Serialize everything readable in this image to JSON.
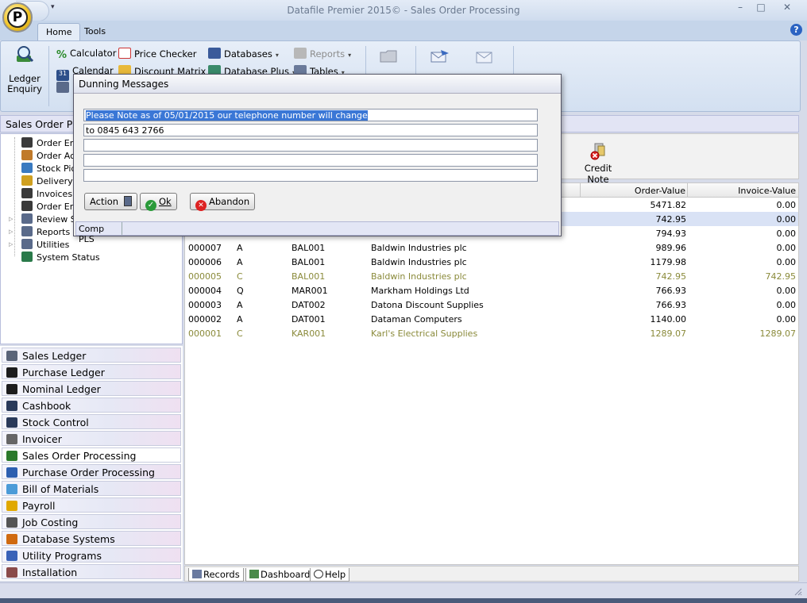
{
  "window": {
    "title": "Datafile  Premier 2015© - Sales Order Processing",
    "logo_letter": "P",
    "qat_arrow": "▾",
    "minimize": "–",
    "maximize": "□",
    "close": "✕"
  },
  "ribbon": {
    "tabs": [
      "Home",
      "Tools"
    ],
    "help": "?",
    "ledger_enquiry": [
      "Ledger",
      "Enquiry"
    ],
    "calculator": "Calculator",
    "calendar": "Calendar",
    "price_checker": "Price Checker",
    "discount_matrix": "Discount Matrix",
    "databases": "Databases",
    "database_plus": "Database Plus",
    "reports": "Reports",
    "tables": "Tables",
    "dropdown_arrow": "▾"
  },
  "left_panel": {
    "header": "Sales Order Processing",
    "tree": [
      {
        "label": "Order Entry",
        "icon": "person-icon"
      },
      {
        "label": "Order Acknowledgement",
        "icon": "briefcase-icon"
      },
      {
        "label": "Stock Picking",
        "icon": "box-icon"
      },
      {
        "label": "Delivery Notes",
        "icon": "document-icon"
      },
      {
        "label": "Invoices",
        "icon": "person-icon"
      },
      {
        "label": "Order Enquiry",
        "icon": "person-icon"
      },
      {
        "label": "Review Sales",
        "icon": "list-icon"
      },
      {
        "label": "Reports",
        "icon": "list-icon"
      },
      {
        "label": "Utilities",
        "icon": "list-icon"
      },
      {
        "label": "System Status",
        "icon": "book-icon"
      }
    ],
    "expander": "▷",
    "modules": [
      {
        "label": "Sales Ledger",
        "color": "#5a6478"
      },
      {
        "label": "Purchase Ledger",
        "color": "#1d1d1d"
      },
      {
        "label": "Nominal Ledger",
        "color": "#1d1d1d"
      },
      {
        "label": "Cashbook",
        "color": "#2a3a5a"
      },
      {
        "label": "Stock Control",
        "color": "#2a3a5a"
      },
      {
        "label": "Invoicer",
        "color": "#666666"
      },
      {
        "label": "Sales Order Processing",
        "color": "#2c7a2c"
      },
      {
        "label": "Purchase Order Processing",
        "color": "#2d5fb0"
      },
      {
        "label": "Bill of Materials",
        "color": "#4b9bd8"
      },
      {
        "label": "Payroll",
        "color": "#e0a800"
      },
      {
        "label": "Job Costing",
        "color": "#555555"
      },
      {
        "label": "Database Systems",
        "color": "#d06a10"
      },
      {
        "label": "Utility Programs",
        "color": "#3a62b8"
      },
      {
        "label": "Installation",
        "color": "#8a4a4a"
      }
    ]
  },
  "toolbar": {
    "credit_note": "Credit Note"
  },
  "grid": {
    "headers": {
      "order_value": "Order-Value",
      "invoice_value": "Invoice-Value"
    },
    "rows": [
      {
        "order": "",
        "status": "",
        "account": "",
        "name": "",
        "order_value": "5471.82",
        "invoice_value": "0.00",
        "style": "normal"
      },
      {
        "order": "",
        "status": "",
        "account": "",
        "name": "",
        "order_value": "742.95",
        "invoice_value": "0.00",
        "style": "sel"
      },
      {
        "order": "",
        "status": "",
        "account": "",
        "name": "",
        "order_value": "794.93",
        "invoice_value": "0.00",
        "style": "normal"
      },
      {
        "order": "000007",
        "status": "A",
        "account": "BAL001",
        "name": "Baldwin Industries plc",
        "order_value": "989.96",
        "invoice_value": "0.00",
        "style": "normal"
      },
      {
        "order": "000006",
        "status": "A",
        "account": "BAL001",
        "name": "Baldwin Industries plc",
        "order_value": "1179.98",
        "invoice_value": "0.00",
        "style": "normal"
      },
      {
        "order": "000005",
        "status": "C",
        "account": "BAL001",
        "name": "Baldwin Industries plc",
        "order_value": "742.95",
        "invoice_value": "742.95",
        "style": "dim"
      },
      {
        "order": "000004",
        "status": "Q",
        "account": "MAR001",
        "name": "Markham Holdings Ltd",
        "order_value": "766.93",
        "invoice_value": "0.00",
        "style": "normal"
      },
      {
        "order": "000003",
        "status": "A",
        "account": "DAT002",
        "name": "Datona Discount Supplies",
        "order_value": "766.93",
        "invoice_value": "0.00",
        "style": "normal"
      },
      {
        "order": "000002",
        "status": "A",
        "account": "DAT001",
        "name": "Dataman Computers",
        "order_value": "1140.00",
        "invoice_value": "0.00",
        "style": "normal"
      },
      {
        "order": "000001",
        "status": "C",
        "account": "KAR001",
        "name": "Karl's Electrical Supplies",
        "order_value": "1289.07",
        "invoice_value": "1289.07",
        "style": "dim"
      }
    ]
  },
  "bottom_tabs": [
    "Records",
    "Dashboard",
    "Help"
  ],
  "dialog": {
    "title": "Dunning Messages",
    "lines": [
      "Please Note as of 05/01/2015 our telephone number will change",
      "to 0845 643 2766",
      "",
      "",
      ""
    ],
    "buttons": {
      "action": "Action",
      "ok": "Ok",
      "abandon": "Abandon"
    },
    "status": "Comp PLS"
  }
}
